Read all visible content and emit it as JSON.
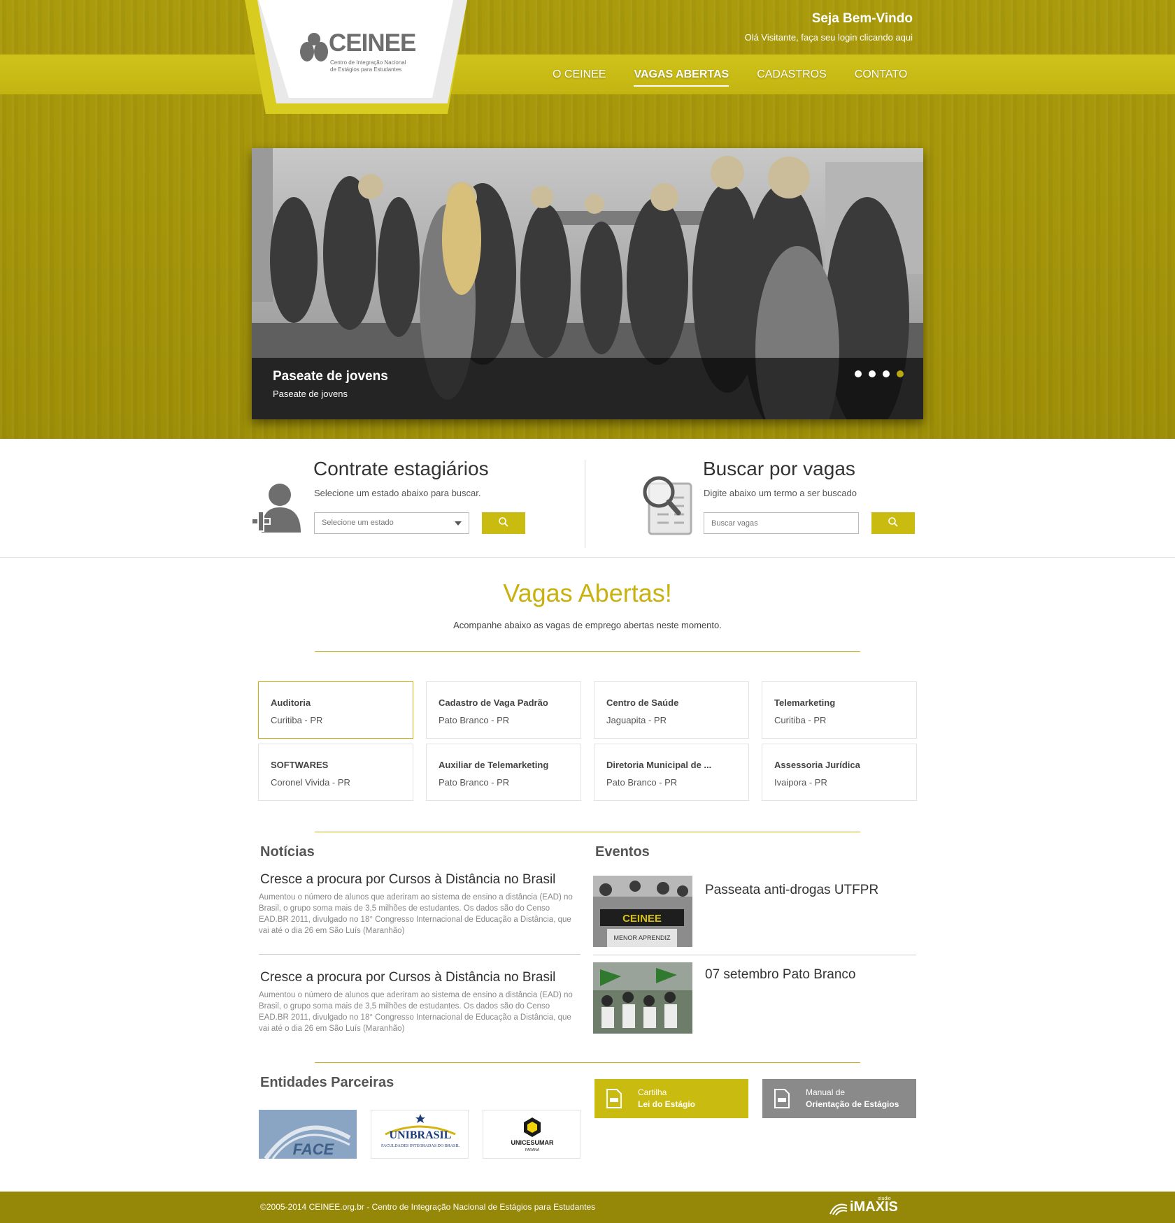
{
  "header": {
    "logo_text": "CEINEE",
    "logo_subtitle": "Centro de Integração Nacional de Estágios para Estudantes",
    "welcome_title": "Seja Bem-Vindo",
    "welcome_login": "Olá Visitante, faça seu login clicando aqui",
    "nav": [
      {
        "label": "O CEINEE",
        "active": false
      },
      {
        "label": "VAGAS ABERTAS",
        "active": true
      },
      {
        "label": "CADASTROS",
        "active": false
      },
      {
        "label": "CONTATO",
        "active": false
      }
    ]
  },
  "slider": {
    "caption_title": "Paseate de jovens",
    "caption_subtitle": "Paseate de jovens",
    "dots": 4,
    "active_dot": 4
  },
  "search": {
    "hire": {
      "title": "Contrate estagiários",
      "subtitle": "Selecione um estado abaixo para buscar.",
      "select_value": "Selecione um estado",
      "icon": "person-add-icon"
    },
    "jobs": {
      "title": "Buscar por vagas",
      "subtitle": "Digite abaixo um termo a ser buscado",
      "placeholder": "Buscar vagas",
      "icon": "document-search-icon"
    }
  },
  "vagas": {
    "title": "Vagas Abertas!",
    "subtitle": "Acompanhe abaixo as vagas de emprego abertas neste momento.",
    "items": [
      {
        "title": "Auditoria",
        "location": "Curitiba - PR"
      },
      {
        "title": "Cadastro de Vaga Padrão",
        "location": "Pato Branco - PR"
      },
      {
        "title": "Centro de Saúde",
        "location": "Jaguapita - PR"
      },
      {
        "title": "Telemarketing",
        "location": "Curitiba - PR"
      },
      {
        "title": "SOFTWARES",
        "location": "Coronel Vivida - PR"
      },
      {
        "title": "Auxiliar de Telemarketing",
        "location": "Pato Branco - PR"
      },
      {
        "title": "Diretoria Municipal de ...",
        "location": "Pato Branco - PR"
      },
      {
        "title": "Assessoria Jurídica",
        "location": "Ivaipora - PR"
      }
    ]
  },
  "news": {
    "heading": "Notícias",
    "items": [
      {
        "title": "Cresce a procura por Cursos à Distância no Brasil",
        "body": "Aumentou o número de alunos que aderiram ao sistema de ensino a distância (EAD) no Brasil, o grupo soma mais de 3,5 milhões de estudantes. Os dados são do Censo EAD.BR 2011, divulgado no 18° Congresso Internacional de Educação a Distância, que vai até o dia 26 em São Luís (Maranhão)"
      },
      {
        "title": "Cresce a procura por Cursos à Distância no Brasil",
        "body": "Aumentou o número de alunos que aderiram ao sistema de ensino a distância (EAD) no Brasil, o grupo soma mais de 3,5 milhões de estudantes. Os dados são do Censo EAD.BR 2011, divulgado no 18° Congresso Internacional de Educação a Distância, que vai até o dia 26 em São Luís (Maranhão)"
      }
    ]
  },
  "events": {
    "heading": "Eventos",
    "items": [
      {
        "title": "Passeata anti-drogas UTFPR",
        "banner_text": "CEINEE",
        "sign_text": "MENOR APRENDIZ"
      },
      {
        "title": "07 setembro Pato Branco"
      }
    ]
  },
  "partners": {
    "heading": "Entidades Parceiras",
    "logos": [
      {
        "name": "FACE"
      },
      {
        "name": "UNIBRASIL",
        "sub": "FACULDADES INTEGRADAS DO BRASIL"
      },
      {
        "name": "UNICESUMAR",
        "sub": "PARANÁ"
      }
    ],
    "downloads": [
      {
        "line1": "Cartilha",
        "line2": "Lei do Estágio",
        "color": "#c9bb10"
      },
      {
        "line1": "Manual de",
        "line2": "Orientação de Estágios",
        "color": "#8a8a8a"
      }
    ]
  },
  "footer": {
    "copyright": "©2005-2014 CEINEE.org.br - Centro de Integração Nacional de Estágios para Estudantes",
    "maker": "iMAXIS",
    "maker_small": "studio"
  },
  "colors": {
    "brand": "#b9a810",
    "accent": "#c9bb10",
    "footer": "#958707"
  }
}
